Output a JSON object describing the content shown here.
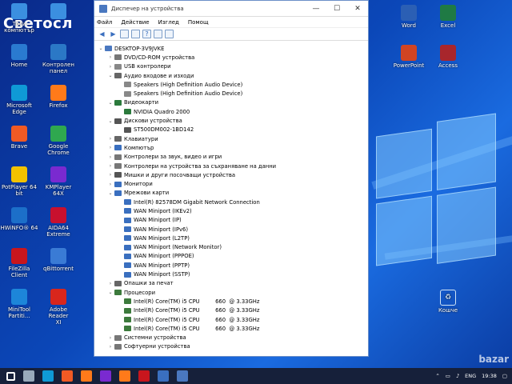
{
  "watermark": "Светосл",
  "bazar_watermark": "bazar",
  "desktop_icons_left": [
    {
      "label": "Този\nкомпютър",
      "icon": "computer-icon",
      "color": "#3b8fe0"
    },
    {
      "label": "Home",
      "icon": "home-icon",
      "color": "#2a7ad0"
    },
    {
      "label": "Microsoft\nEdge",
      "icon": "edge-icon",
      "color": "#0f9ad6"
    },
    {
      "label": "Brave",
      "icon": "brave-icon",
      "color": "#f05a24"
    },
    {
      "label": "PotPlayer 64\nbit",
      "icon": "potplayer-icon",
      "color": "#f2c200"
    },
    {
      "label": "HWiNFO® 64",
      "icon": "hwinfo-icon",
      "color": "#1c6fc9"
    },
    {
      "label": "FileZilla Client",
      "icon": "filezilla-icon",
      "color": "#c8161d"
    },
    {
      "label": "MiniTool\nPartiti...",
      "icon": "minitool-icon",
      "color": "#1d86d9"
    }
  ],
  "desktop_icons_col2": [
    {
      "label": "",
      "icon": "network-icon",
      "color": "#3b8fe0"
    },
    {
      "label": "Контролен\nпанел",
      "icon": "control-panel-icon",
      "color": "#2b78c6"
    },
    {
      "label": "Firefox",
      "icon": "firefox-icon",
      "color": "#ff7a1a"
    },
    {
      "label": "Google\nChrome",
      "icon": "chrome-icon",
      "color": "#2fa84f"
    },
    {
      "label": "KMPlayer 64X",
      "icon": "kmplayer-icon",
      "color": "#7a2ad0"
    },
    {
      "label": "AIDA64\nExtreme",
      "icon": "aida64-icon",
      "color": "#c8102e"
    },
    {
      "label": "qBittorrent",
      "icon": "qbittorrent-icon",
      "color": "#3a7bd5"
    },
    {
      "label": "Adobe Reader\nXI",
      "icon": "adobe-reader-icon",
      "color": "#d8261c"
    }
  ],
  "desktop_icons_right": [
    {
      "label": "Word",
      "icon": "word-icon",
      "color": "#2b5fb4"
    },
    {
      "label": "Excel",
      "icon": "excel-icon",
      "color": "#1f7a44"
    },
    {
      "label": "PowerPoint",
      "icon": "powerpoint-icon",
      "color": "#d04423"
    },
    {
      "label": "Access",
      "icon": "access-icon",
      "color": "#a8262c"
    }
  ],
  "recycle_bin": {
    "label": "Кошче"
  },
  "window": {
    "title": "Диспечер на устройства",
    "menu": [
      "Файл",
      "Действие",
      "Изглед",
      "Помощ"
    ]
  },
  "tree": [
    {
      "text": "DESKTOP-3V9JVKE",
      "level": 0,
      "expander": "v",
      "color": "#4a78c0"
    },
    {
      "text": "DVD/CD-ROM устройства",
      "level": 1,
      "expander": ">",
      "color": "#777"
    },
    {
      "text": "USB контролери",
      "level": 1,
      "expander": ">",
      "color": "#888"
    },
    {
      "text": "Аудио входове и изходи",
      "level": 1,
      "expander": "v",
      "color": "#666"
    },
    {
      "text": "Speakers (High Definition Audio Device)",
      "level": 2,
      "expander": "",
      "color": "#888"
    },
    {
      "text": "Speakers (High Definition Audio Device)",
      "level": 2,
      "expander": "",
      "color": "#888"
    },
    {
      "text": "Видеокарти",
      "level": 1,
      "expander": "v",
      "color": "#2b7a3c"
    },
    {
      "text": "NVIDIA Quadro 2000",
      "level": 2,
      "expander": "",
      "color": "#2b7a3c"
    },
    {
      "text": "Дискови устройства",
      "level": 1,
      "expander": "v",
      "color": "#555"
    },
    {
      "text": "ST500DM002-1BD142",
      "level": 2,
      "expander": "",
      "color": "#555"
    },
    {
      "text": "Клавиатури",
      "level": 1,
      "expander": ">",
      "color": "#666"
    },
    {
      "text": "Компютър",
      "level": 1,
      "expander": ">",
      "color": "#3a6fbf"
    },
    {
      "text": "Контролери за звук, видео и игри",
      "level": 1,
      "expander": ">",
      "color": "#777"
    },
    {
      "text": "Контролери на устройства за съхраняване на данни",
      "level": 1,
      "expander": ">",
      "color": "#777"
    },
    {
      "text": "Мишки и други посочващи устройства",
      "level": 1,
      "expander": ">",
      "color": "#555"
    },
    {
      "text": "Монитори",
      "level": 1,
      "expander": ">",
      "color": "#3a6fbf"
    },
    {
      "text": "Мрежови карти",
      "level": 1,
      "expander": "v",
      "color": "#3a6fbf"
    },
    {
      "text": "Intel(R) 82578DM Gigabit Network Connection",
      "level": 2,
      "expander": "",
      "color": "#3a6fbf"
    },
    {
      "text": "WAN Miniport (IKEv2)",
      "level": 2,
      "expander": "",
      "color": "#3a6fbf"
    },
    {
      "text": "WAN Miniport (IP)",
      "level": 2,
      "expander": "",
      "color": "#3a6fbf"
    },
    {
      "text": "WAN Miniport (IPv6)",
      "level": 2,
      "expander": "",
      "color": "#3a6fbf"
    },
    {
      "text": "WAN Miniport (L2TP)",
      "level": 2,
      "expander": "",
      "color": "#3a6fbf"
    },
    {
      "text": "WAN Miniport (Network Monitor)",
      "level": 2,
      "expander": "",
      "color": "#3a6fbf"
    },
    {
      "text": "WAN Miniport (PPPOE)",
      "level": 2,
      "expander": "",
      "color": "#3a6fbf"
    },
    {
      "text": "WAN Miniport (PPTP)",
      "level": 2,
      "expander": "",
      "color": "#3a6fbf"
    },
    {
      "text": "WAN Miniport (SSTP)",
      "level": 2,
      "expander": "",
      "color": "#3a6fbf"
    },
    {
      "text": "Опашки за печат",
      "level": 1,
      "expander": ">",
      "color": "#666"
    },
    {
      "text": "Процесори",
      "level": 1,
      "expander": "v",
      "color": "#3c7a3c"
    },
    {
      "text": "Intel(R) Core(TM) i5 CPU         660  @ 3.33GHz",
      "level": 2,
      "expander": "",
      "color": "#3c7a3c"
    },
    {
      "text": "Intel(R) Core(TM) i5 CPU         660  @ 3.33GHz",
      "level": 2,
      "expander": "",
      "color": "#3c7a3c"
    },
    {
      "text": "Intel(R) Core(TM) i5 CPU         660  @ 3.33GHz",
      "level": 2,
      "expander": "",
      "color": "#3c7a3c"
    },
    {
      "text": "Intel(R) Core(TM) i5 CPU         660  @ 3.33GHz",
      "level": 2,
      "expander": "",
      "color": "#3c7a3c"
    },
    {
      "text": "Системни устройства",
      "level": 1,
      "expander": ">",
      "color": "#777"
    },
    {
      "text": "Софтуерни устройства",
      "level": 1,
      "expander": ">",
      "color": "#777"
    }
  ],
  "taskbar": {
    "apps": [
      {
        "icon": "start-icon",
        "color": "#ffffff"
      },
      {
        "icon": "task-view-icon",
        "color": "#9ab"
      },
      {
        "icon": "edge-icon",
        "color": "#0f9ad6"
      },
      {
        "icon": "brave-icon",
        "color": "#f05a24"
      },
      {
        "icon": "firefox-icon",
        "color": "#ff7a1a"
      },
      {
        "icon": "kmplayer-icon",
        "color": "#7a2ad0"
      },
      {
        "icon": "firefox-icon",
        "color": "#ff7a1a"
      },
      {
        "icon": "filezilla-icon",
        "color": "#c8161d"
      },
      {
        "icon": "app-icon",
        "color": "#3a6fbf"
      },
      {
        "icon": "device-manager-icon",
        "color": "#4a78c0"
      }
    ],
    "language": "ENG",
    "time": "19:38"
  }
}
